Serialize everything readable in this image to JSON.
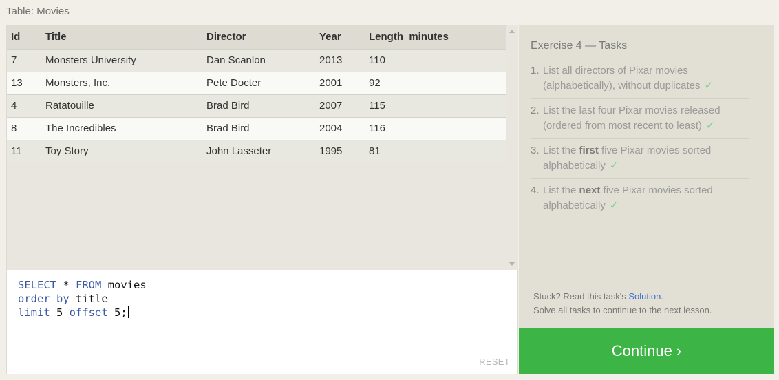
{
  "table_caption": "Table: Movies",
  "table": {
    "columns": [
      "Id",
      "Title",
      "Director",
      "Year",
      "Length_minutes"
    ],
    "rows": [
      [
        "7",
        "Monsters University",
        "Dan Scanlon",
        "2013",
        "110"
      ],
      [
        "13",
        "Monsters, Inc.",
        "Pete Docter",
        "2001",
        "92"
      ],
      [
        "4",
        "Ratatouille",
        "Brad Bird",
        "2007",
        "115"
      ],
      [
        "8",
        "The Incredibles",
        "Brad Bird",
        "2004",
        "116"
      ],
      [
        "11",
        "Toy Story",
        "John Lasseter",
        "1995",
        "81"
      ]
    ]
  },
  "editor": {
    "lines": [
      [
        {
          "t": "SELECT",
          "k": true
        },
        {
          "t": " * ",
          "k": false
        },
        {
          "t": "FROM",
          "k": true
        },
        {
          "t": " movies",
          "k": false
        }
      ],
      [
        {
          "t": "order",
          "k": true
        },
        {
          "t": " ",
          "k": false
        },
        {
          "t": "by",
          "k": true
        },
        {
          "t": " title",
          "k": false
        }
      ],
      [
        {
          "t": "limit",
          "k": true
        },
        {
          "t": " 5 ",
          "k": false
        },
        {
          "t": "offset",
          "k": true
        },
        {
          "t": " 5;",
          "k": false
        }
      ]
    ],
    "reset_label": "RESET"
  },
  "exercise": {
    "title": "Exercise 4 — Tasks",
    "tasks": [
      {
        "num": "1.",
        "parts": [
          {
            "t": "List all directors of Pixar movies (alphabetically), without duplicates",
            "b": false
          }
        ],
        "done": true
      },
      {
        "num": "2.",
        "parts": [
          {
            "t": "List the last four Pixar movies released (ordered from most recent to least)",
            "b": false
          }
        ],
        "done": true
      },
      {
        "num": "3.",
        "parts": [
          {
            "t": "List the ",
            "b": false
          },
          {
            "t": "first",
            "b": true
          },
          {
            "t": " five Pixar movies sorted alphabetically",
            "b": false
          }
        ],
        "done": true
      },
      {
        "num": "4.",
        "parts": [
          {
            "t": "List the ",
            "b": false
          },
          {
            "t": "next",
            "b": true
          },
          {
            "t": " five Pixar movies sorted alphabetically",
            "b": false
          }
        ],
        "done": true
      }
    ],
    "check_mark": "✓",
    "stuck_prefix": "Stuck? Read this task's ",
    "solution_link": "Solution",
    "stuck_suffix": ".",
    "solve_note": "Solve all tasks to continue to the next lesson."
  },
  "continue_label": "Continue ›"
}
